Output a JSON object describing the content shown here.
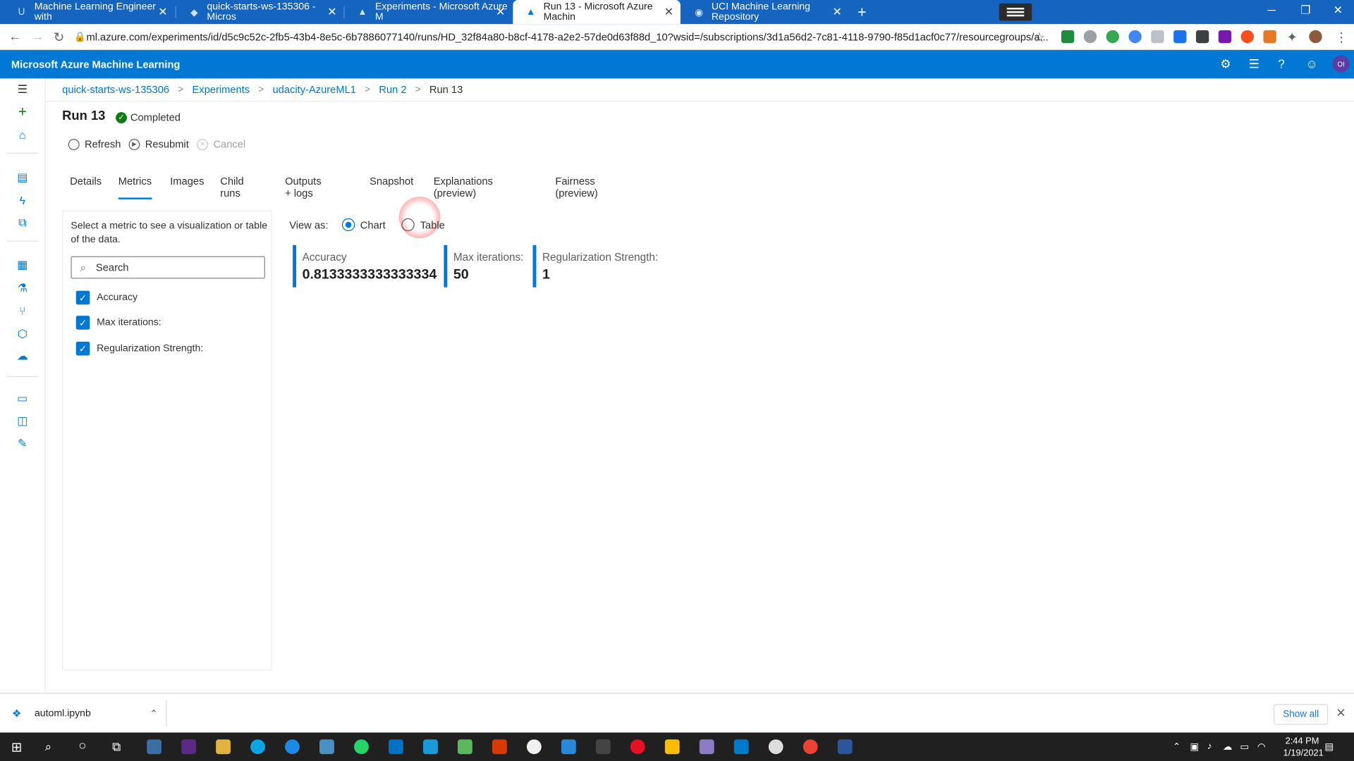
{
  "browser": {
    "tabs": [
      {
        "title": "Machine Learning Engineer with",
        "active": false
      },
      {
        "title": "quick-starts-ws-135306 - Micros",
        "active": false
      },
      {
        "title": "Experiments - Microsoft Azure M",
        "active": false
      },
      {
        "title": "Run 13 - Microsoft Azure Machin",
        "active": true
      },
      {
        "title": "UCI Machine Learning Repository",
        "active": false
      }
    ],
    "url": "ml.azure.com/experiments/id/d5c9c52c-2fb5-43b4-8e5c-6b7886077140/runs/HD_32f84a80-b8cf-4178-a2e2-57de0d63f88d_10?wsid=/subscriptions/3d1a56d2-7c81-4118-9790-f85d1acf0c77/resourcegroups/a..."
  },
  "app": {
    "name": "Microsoft Azure Machine Learning",
    "accent": "#0078d4",
    "user_initials": "OI"
  },
  "breadcrumb": [
    "quick-starts-ws-135306",
    "Experiments",
    "udacity-AzureML1",
    "Run 2",
    "Run 13"
  ],
  "run": {
    "title": "Run 13",
    "status": "Completed",
    "status_color": "#107c10"
  },
  "commands": {
    "refresh": "Refresh",
    "resubmit": "Resubmit",
    "cancel": "Cancel"
  },
  "tabs": [
    "Details",
    "Metrics",
    "Images",
    "Child runs",
    "Outputs + logs",
    "Snapshot",
    "Explanations (preview)",
    "Fairness (preview)"
  ],
  "selected_tab": "Metrics",
  "metrics_panel": {
    "hint": "Select a metric to see a visualization or table of the data.",
    "search_placeholder": "Search",
    "metrics": [
      {
        "label": "Accuracy",
        "checked": true
      },
      {
        "label": "Max iterations:",
        "checked": true
      },
      {
        "label": "Regularization Strength:",
        "checked": true
      }
    ]
  },
  "view_as": {
    "label": "View as:",
    "chart": "Chart",
    "table": "Table",
    "selected": "Chart"
  },
  "metric_cards": [
    {
      "label": "Accuracy",
      "value": "0.8133333333333334"
    },
    {
      "label": "Max iterations:",
      "value": "50"
    },
    {
      "label": "Regularization Strength:",
      "value": "1"
    }
  ],
  "downloads": {
    "file": "automl.ipynb",
    "show_all": "Show all"
  },
  "taskbar": {
    "time": "2:44 PM",
    "date": "1/19/2021"
  }
}
